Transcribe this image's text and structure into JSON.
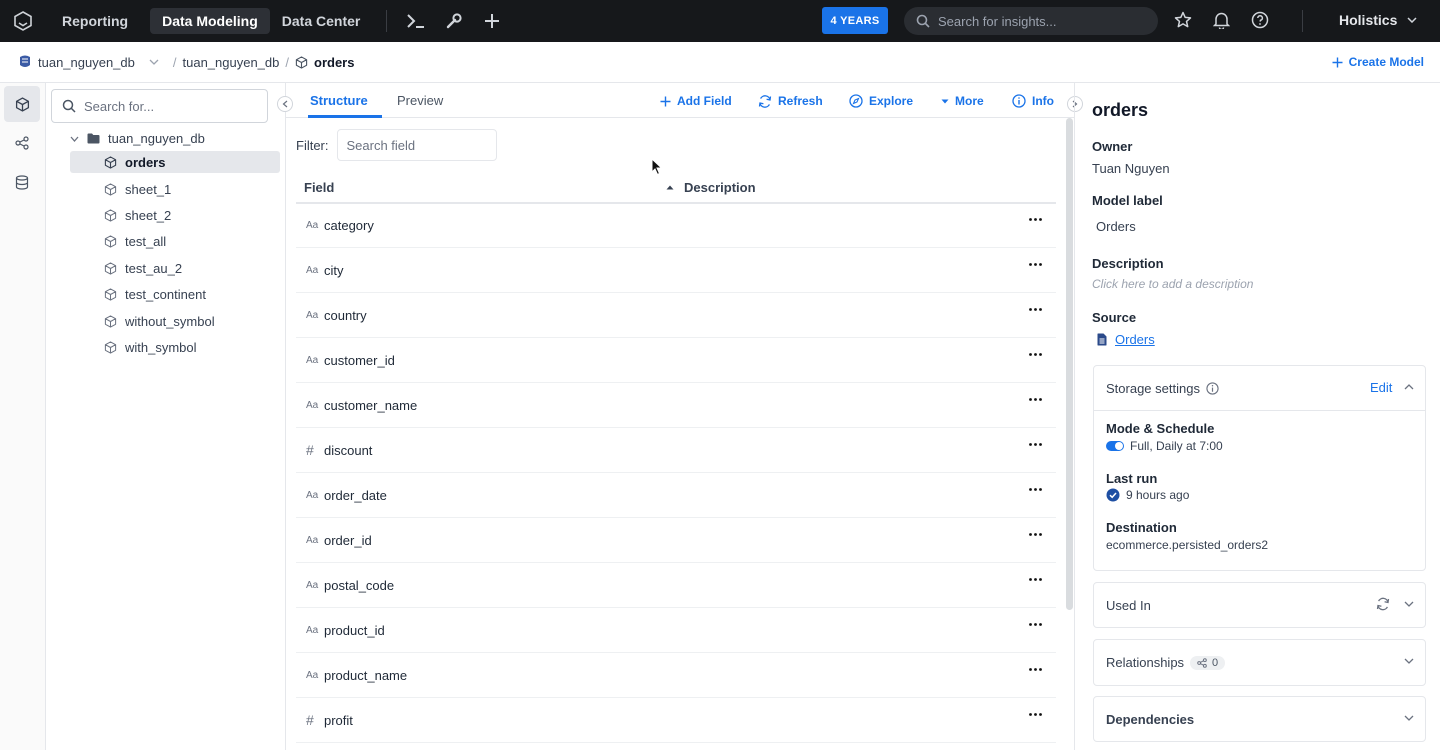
{
  "topbar": {
    "tabs": [
      "Reporting",
      "Data Modeling",
      "Data Center"
    ],
    "active_tab": "Data Modeling",
    "years_badge": "4 YEARS",
    "search_placeholder": "Search for insights...",
    "workspace": "Holistics"
  },
  "breadcrumb": {
    "database": "tuan_nguyen_db",
    "folder": "tuan_nguyen_db",
    "model": "orders",
    "create_model": "Create Model"
  },
  "tree": {
    "search_placeholder": "Search for...",
    "root": "tuan_nguyen_db",
    "items": [
      "orders",
      "sheet_1",
      "sheet_2",
      "test_all",
      "test_au_2",
      "test_continent",
      "without_symbol",
      "with_symbol"
    ],
    "active_item": "orders"
  },
  "editor": {
    "tabs": [
      "Structure",
      "Preview"
    ],
    "active_tab": "Structure",
    "actions": [
      "Add Field",
      "Refresh",
      "Explore",
      "More",
      "Info"
    ],
    "filter_label": "Filter:",
    "filter_placeholder": "Search field",
    "columns": [
      "Field",
      "Description"
    ],
    "fields": [
      {
        "type": "text",
        "type_glyph": "Aa",
        "name": "category"
      },
      {
        "type": "text",
        "type_glyph": "Aa",
        "name": "city"
      },
      {
        "type": "text",
        "type_glyph": "Aa",
        "name": "country"
      },
      {
        "type": "text",
        "type_glyph": "Aa",
        "name": "customer_id"
      },
      {
        "type": "text",
        "type_glyph": "Aa",
        "name": "customer_name"
      },
      {
        "type": "number",
        "type_glyph": "#",
        "name": "discount"
      },
      {
        "type": "text",
        "type_glyph": "Aa",
        "name": "order_date"
      },
      {
        "type": "text",
        "type_glyph": "Aa",
        "name": "order_id"
      },
      {
        "type": "text",
        "type_glyph": "Aa",
        "name": "postal_code"
      },
      {
        "type": "text",
        "type_glyph": "Aa",
        "name": "product_id"
      },
      {
        "type": "text",
        "type_glyph": "Aa",
        "name": "product_name"
      },
      {
        "type": "number",
        "type_glyph": "#",
        "name": "profit"
      }
    ]
  },
  "info": {
    "title": "orders",
    "owner_label": "Owner",
    "owner": "Tuan Nguyen",
    "model_label_label": "Model label",
    "model_label": "Orders",
    "description_label": "Description",
    "description_hint": "Click here to add a description",
    "source_label": "Source",
    "source": "Orders",
    "storage": {
      "title": "Storage settings",
      "edit": "Edit",
      "mode_label": "Mode & Schedule",
      "mode_value": "Full, Daily at 7:00",
      "last_run_label": "Last run",
      "last_run_value": "9 hours ago",
      "destination_label": "Destination",
      "destination_value": "ecommerce.persisted_orders2"
    },
    "used_in": "Used In",
    "relationships": "Relationships",
    "relationships_count": "0",
    "dependencies": "Dependencies"
  },
  "colors": {
    "accent": "#1a73e8",
    "topbar": "#16181b"
  }
}
